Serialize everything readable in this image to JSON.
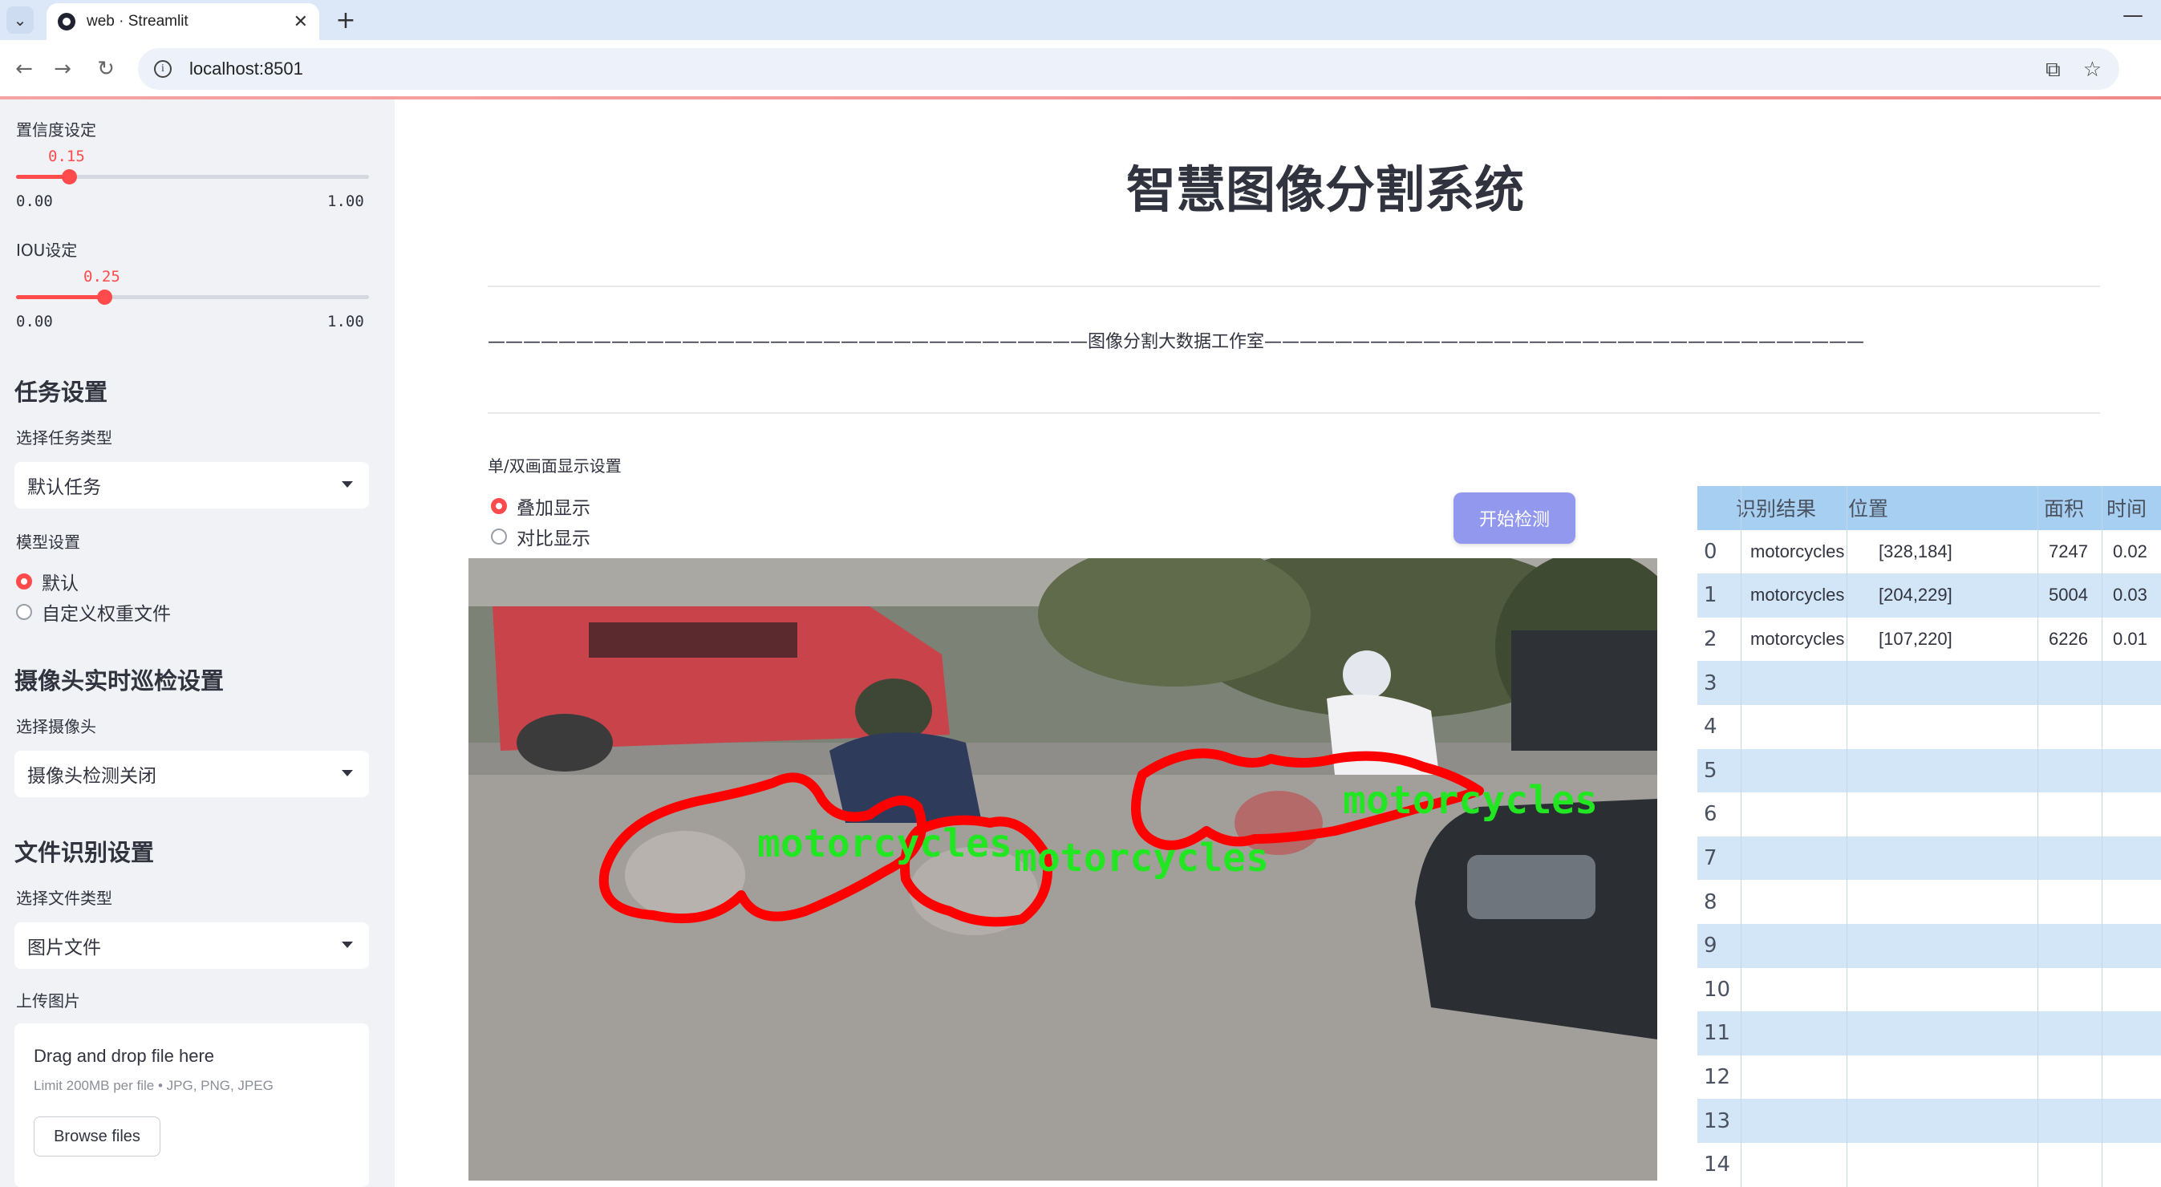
{
  "browser": {
    "tab_title": "web · Streamlit",
    "url": "localhost:8501"
  },
  "sidebar": {
    "confidence": {
      "label": "置信度设定",
      "value": "0.15",
      "fraction": 0.15,
      "min": "0.00",
      "max": "1.00"
    },
    "iou": {
      "label": "IOU设定",
      "value": "0.25",
      "fraction": 0.25,
      "min": "0.00",
      "max": "1.00"
    },
    "task_section": "任务设置",
    "task_type_label": "选择任务类型",
    "task_type_value": "默认任务",
    "model_label": "模型设置",
    "model_options": [
      "默认",
      "自定义权重文件"
    ],
    "camera_section": "摄像头实时巡检设置",
    "camera_label": "选择摄像头",
    "camera_value": "摄像头检测关闭",
    "file_section": "文件识别设置",
    "file_type_label": "选择文件类型",
    "file_type_value": "图片文件",
    "upload_label": "上传图片",
    "upload_title": "Drag and drop file here",
    "upload_limit": "Limit 200MB per file • JPG, PNG, JPEG",
    "browse_label": "Browse files"
  },
  "main": {
    "title": "智慧图像分割系统",
    "studio_line": "——————————————————————————————————图像分割大数据工作室——————————————————————————————————",
    "display_label": "单/双画面显示设置",
    "display_options": [
      "叠加显示",
      "对比显示"
    ],
    "start_button": "开始检测",
    "overlay_labels": [
      "motorcycles",
      "motorcycles",
      "motorcycles"
    ]
  },
  "table": {
    "headers": [
      "识别结果",
      "位置",
      "面积",
      "时间"
    ],
    "rows": [
      {
        "idx": "0",
        "cls": "motorcycles",
        "pos": "[328,184]",
        "area": "7247",
        "time": "0.02"
      },
      {
        "idx": "1",
        "cls": "motorcycles",
        "pos": "[204,229]",
        "area": "5004",
        "time": "0.03"
      },
      {
        "idx": "2",
        "cls": "motorcycles",
        "pos": "[107,220]",
        "area": "6226",
        "time": "0.01"
      },
      {
        "idx": "3"
      },
      {
        "idx": "4"
      },
      {
        "idx": "5"
      },
      {
        "idx": "6"
      },
      {
        "idx": "7"
      },
      {
        "idx": "8"
      },
      {
        "idx": "9"
      },
      {
        "idx": "10"
      },
      {
        "idx": "11"
      },
      {
        "idx": "12"
      },
      {
        "idx": "13"
      },
      {
        "idx": "14"
      }
    ]
  },
  "colors": {
    "accent": "#ff4b4b",
    "button": "#9198ee",
    "table_header": "#a7cff1",
    "table_alt": "#d2e6f8",
    "mask": "#ff0000",
    "label_text": "#22e622"
  }
}
